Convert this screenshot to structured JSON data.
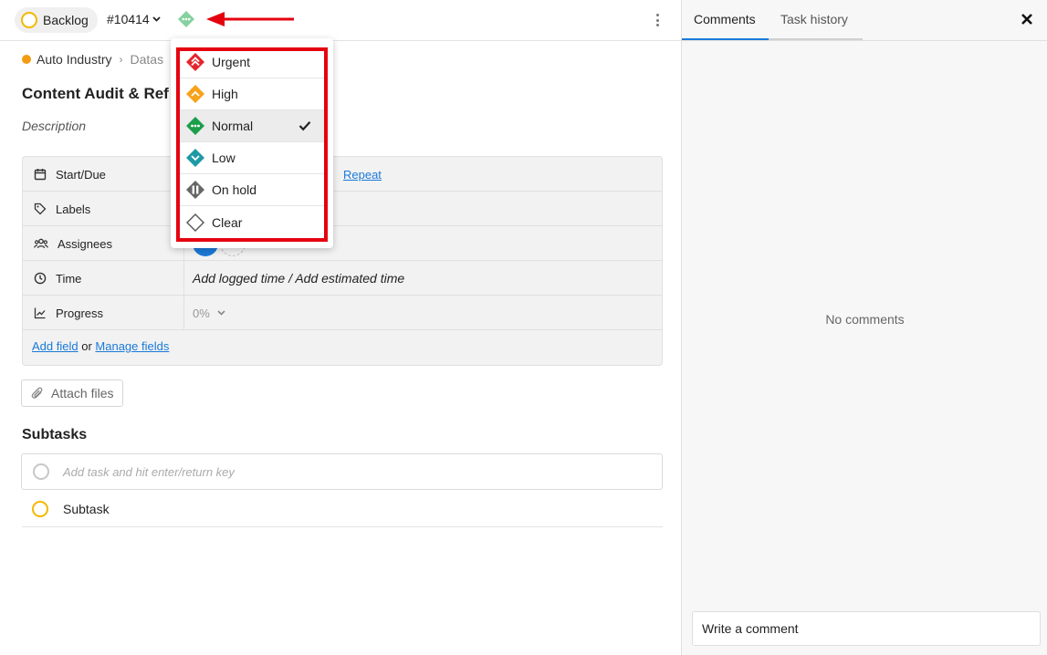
{
  "header": {
    "status_label": "Backlog",
    "task_id": "#10414",
    "priority_current": "normal-priority-icon"
  },
  "breadcrumb": {
    "project": "Auto Industry",
    "section": "Datas"
  },
  "task": {
    "title": "Content Audit & Ref",
    "description_placeholder": "Description"
  },
  "fields": {
    "start_due": {
      "label": "Start/Due",
      "repeat_link": "Repeat"
    },
    "labels": {
      "label": "Labels"
    },
    "assignees": {
      "label": "Assignees"
    },
    "time": {
      "label": "Time",
      "value": "Add logged time / Add estimated time"
    },
    "progress": {
      "label": "Progress",
      "value": "0%"
    },
    "add_field_link": "Add field",
    "or_text": "or",
    "manage_fields_link": "Manage fields"
  },
  "attach": {
    "label": "Attach files"
  },
  "subtasks": {
    "title": "Subtasks",
    "add_placeholder": "Add task and hit enter/return key",
    "items": [
      {
        "label": "Subtask"
      }
    ]
  },
  "priority_menu": {
    "items": [
      {
        "label": "Urgent",
        "icon": "urgent-priority-icon",
        "color": "#e5242b",
        "selected": false
      },
      {
        "label": "High",
        "icon": "high-priority-icon",
        "color": "#f7a21a",
        "selected": false
      },
      {
        "label": "Normal",
        "icon": "normal-priority-icon",
        "color": "#1b9e4b",
        "selected": true
      },
      {
        "label": "Low",
        "icon": "low-priority-icon",
        "color": "#1d9aa6",
        "selected": false
      },
      {
        "label": "On hold",
        "icon": "on-hold-priority-icon",
        "color": "#666666",
        "selected": false
      },
      {
        "label": "Clear",
        "icon": "clear-priority-icon",
        "color": "#555555",
        "selected": false
      }
    ]
  },
  "side_panel": {
    "tabs": [
      {
        "label": "Comments",
        "active": true
      },
      {
        "label": "Task history",
        "active": false
      }
    ],
    "empty_text": "No comments",
    "comment_placeholder": "Write a comment"
  },
  "colors": {
    "accent": "#1a7ad8",
    "annotation_red": "#e5000f",
    "status_yellow": "#f5b800",
    "project_orange": "#f39c12"
  }
}
